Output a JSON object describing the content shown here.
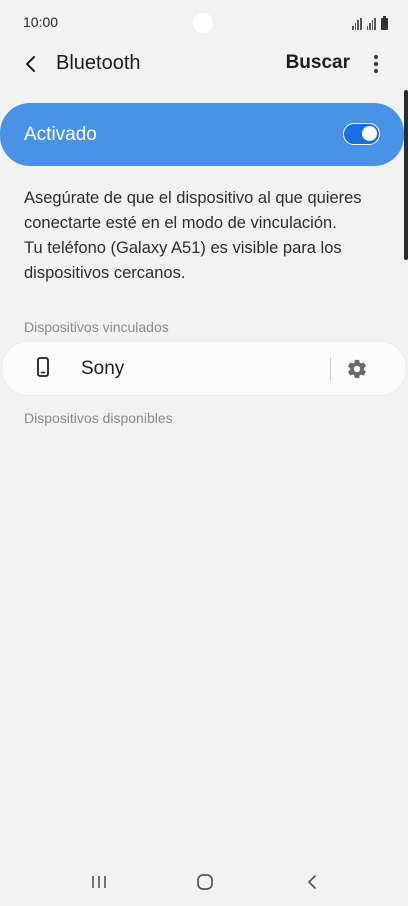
{
  "status_bar": {
    "time": "10:00"
  },
  "header": {
    "title": "Bluetooth",
    "search_label": "Buscar",
    "back_icon": "chevron-left-icon",
    "more_icon": "more-vertical-icon"
  },
  "master_switch": {
    "label": "Activado",
    "state": "on",
    "color": "#4a92e8"
  },
  "description": {
    "lines": [
      "Asegúrate de que el dispositivo al que quieres",
      "conectarte esté en el modo de vinculación.",
      "Tu teléfono (Galaxy A51) es visible para los",
      "dispositivos cercanos."
    ]
  },
  "paired": {
    "section_label": "Dispositivos vinculados",
    "devices": [
      {
        "name": "Sony",
        "icon": "phone-icon",
        "action_icon": "gear-icon"
      }
    ]
  },
  "available": {
    "section_label": "Dispositivos disponibles"
  },
  "nav_bar": {
    "recents_icon": "recents-icon",
    "home_icon": "home-icon",
    "back_icon": "back-icon"
  }
}
